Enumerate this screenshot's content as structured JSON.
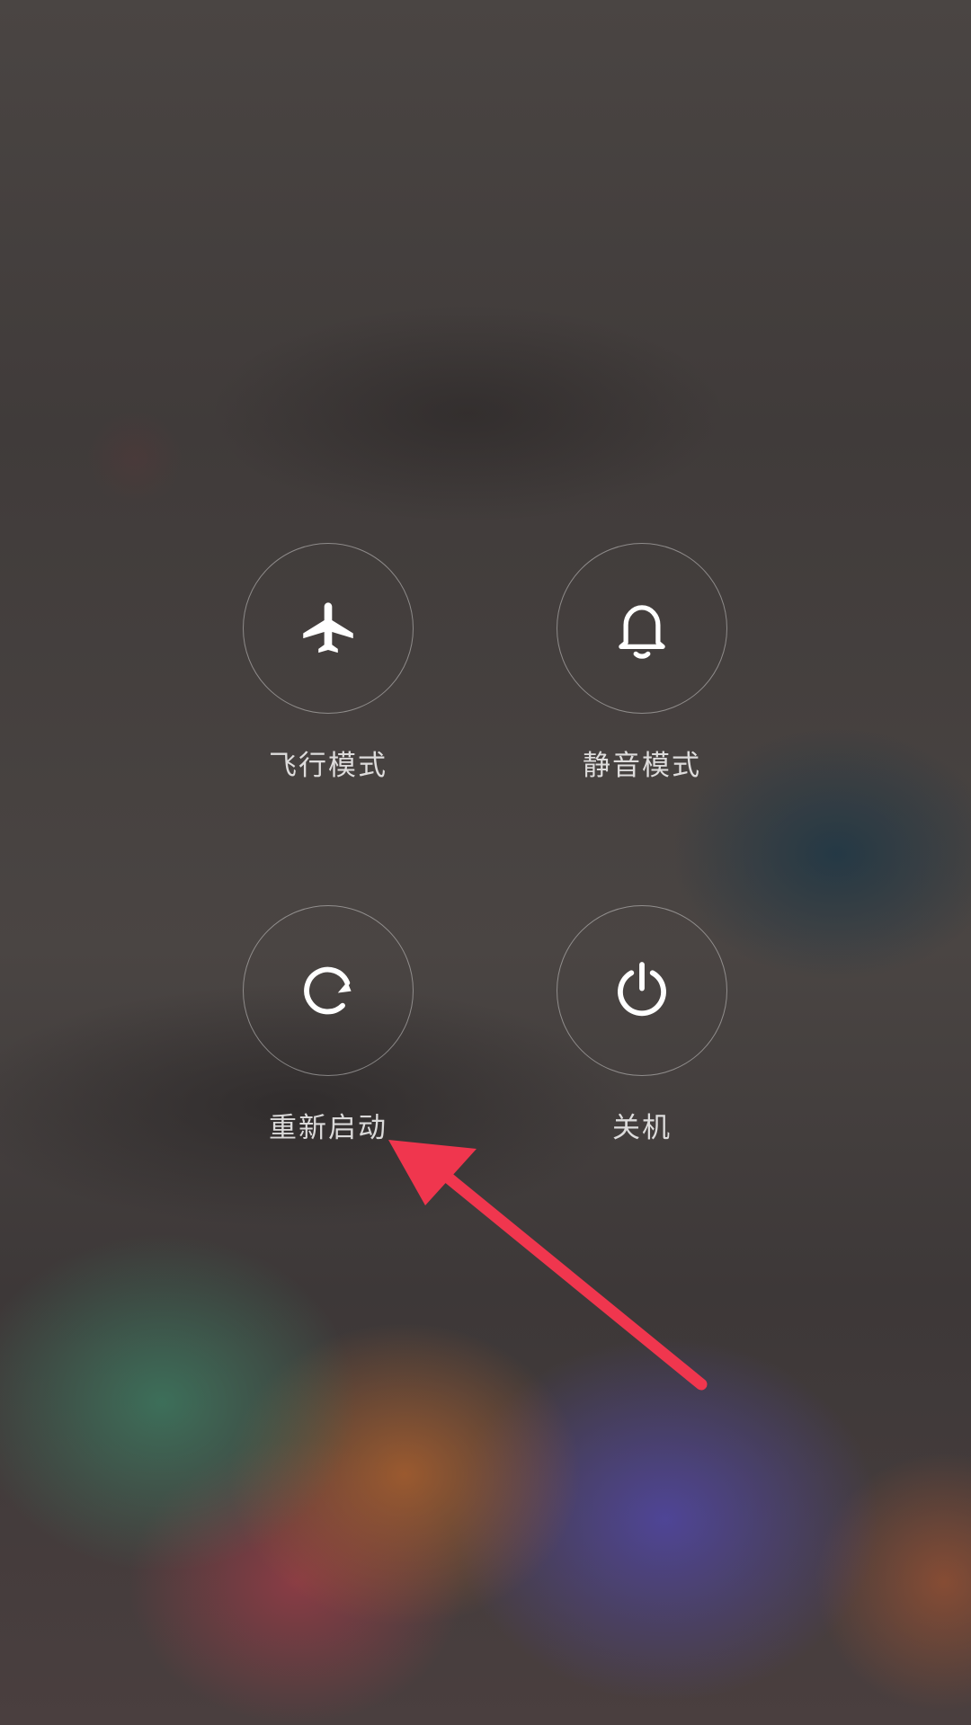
{
  "power_menu": {
    "airplane_mode": {
      "label": "飞行模式",
      "icon": "airplane-icon"
    },
    "silent_mode": {
      "label": "静音模式",
      "icon": "bell-icon"
    },
    "restart": {
      "label": "重新启动",
      "icon": "restart-icon"
    },
    "power_off": {
      "label": "关机",
      "icon": "power-icon"
    }
  },
  "annotation": {
    "icon": "red-arrow-pointer",
    "color": "#f0364e",
    "points_to": "restart"
  },
  "colors": {
    "icon_white": "#ffffff",
    "ring": "rgba(255,255,255,0.4)"
  }
}
